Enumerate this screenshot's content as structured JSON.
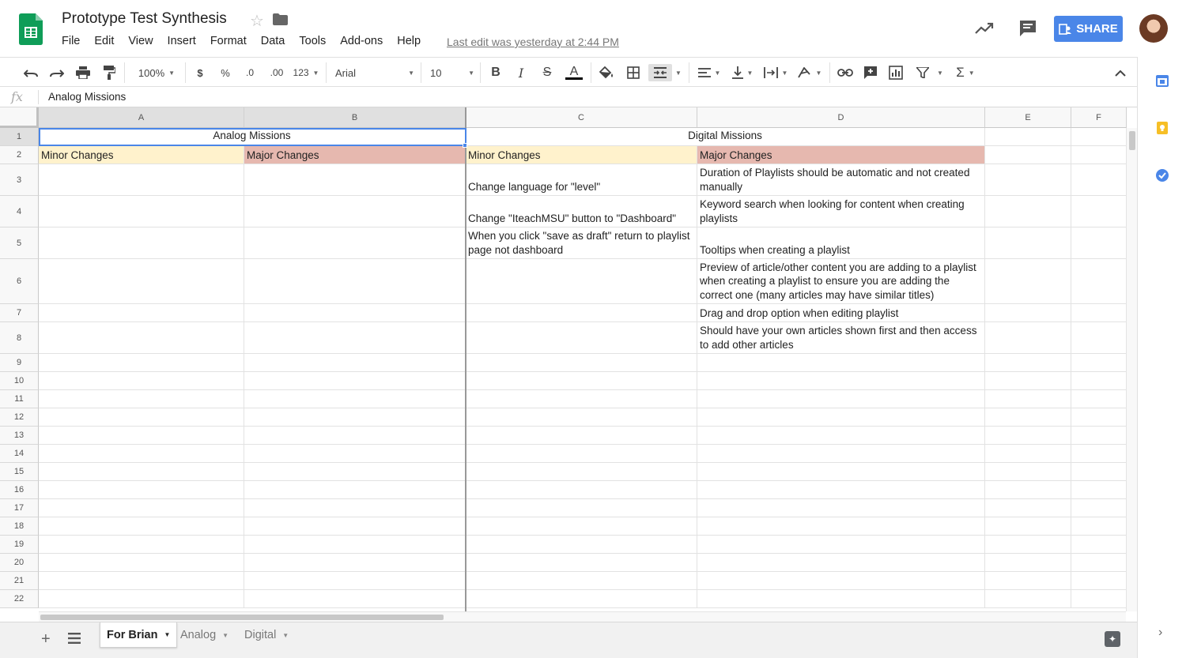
{
  "app": {
    "title": "Prototype Test Synthesis",
    "last_edit": "Last edit was yesterday at 2:44 PM",
    "share_label": "SHARE",
    "accent_color": "#4a86e8",
    "logo_color": "#0f9d58"
  },
  "menu": [
    "File",
    "Edit",
    "View",
    "Insert",
    "Format",
    "Data",
    "Tools",
    "Add-ons",
    "Help"
  ],
  "toolbar": {
    "zoom": "100%",
    "currency": "$",
    "percent": "%",
    "decrease_decimal": ".0",
    "increase_decimal": ".00",
    "more_formats": "123",
    "font": "Arial",
    "font_size": "10",
    "bold": "B",
    "italic": "I",
    "strikethrough": "S",
    "text_color": "A"
  },
  "formula_bar": {
    "fx": "fx",
    "value": "Analog Missions"
  },
  "grid": {
    "columns": [
      "A",
      "B",
      "C",
      "D",
      "E",
      "F"
    ],
    "rows": [
      "1",
      "2",
      "3",
      "4",
      "5",
      "6",
      "7",
      "8",
      "9",
      "10",
      "11",
      "12",
      "13",
      "14",
      "15",
      "16",
      "17",
      "18",
      "19",
      "20",
      "21",
      "22"
    ],
    "cells": {
      "r1_ab": "Analog Missions",
      "r1_cd": "Digital Missions",
      "a2": "Minor Changes",
      "b2": "Major Changes",
      "c2": "Minor Changes",
      "d2": "Major Changes",
      "c3": "Change language for \"level\"",
      "d3": "Duration of Playlists should be automatic and not created manually",
      "c4": "Change \"IteachMSU\" button to \"Dashboard\"",
      "d4": "Keyword search when looking for content when creating playlists",
      "c5": "When you click \"save as draft\" return to playlist page not dashboard",
      "d5": "Tooltips when creating a playlist",
      "d6": "Preview of article/other content you are adding to a playlist when creating a playlist to ensure you are adding the correct one (many articles may have similar titles)",
      "d7": "Drag and drop option when editing playlist",
      "d8": "Should have your own articles shown first and then access to add other articles"
    },
    "colors": {
      "minor_fill": "#fff2cc",
      "major_fill": "#e6b8af"
    }
  },
  "sheets": {
    "tabs": [
      "For Brian",
      "Analog",
      "Digital"
    ],
    "active": "For Brian"
  }
}
